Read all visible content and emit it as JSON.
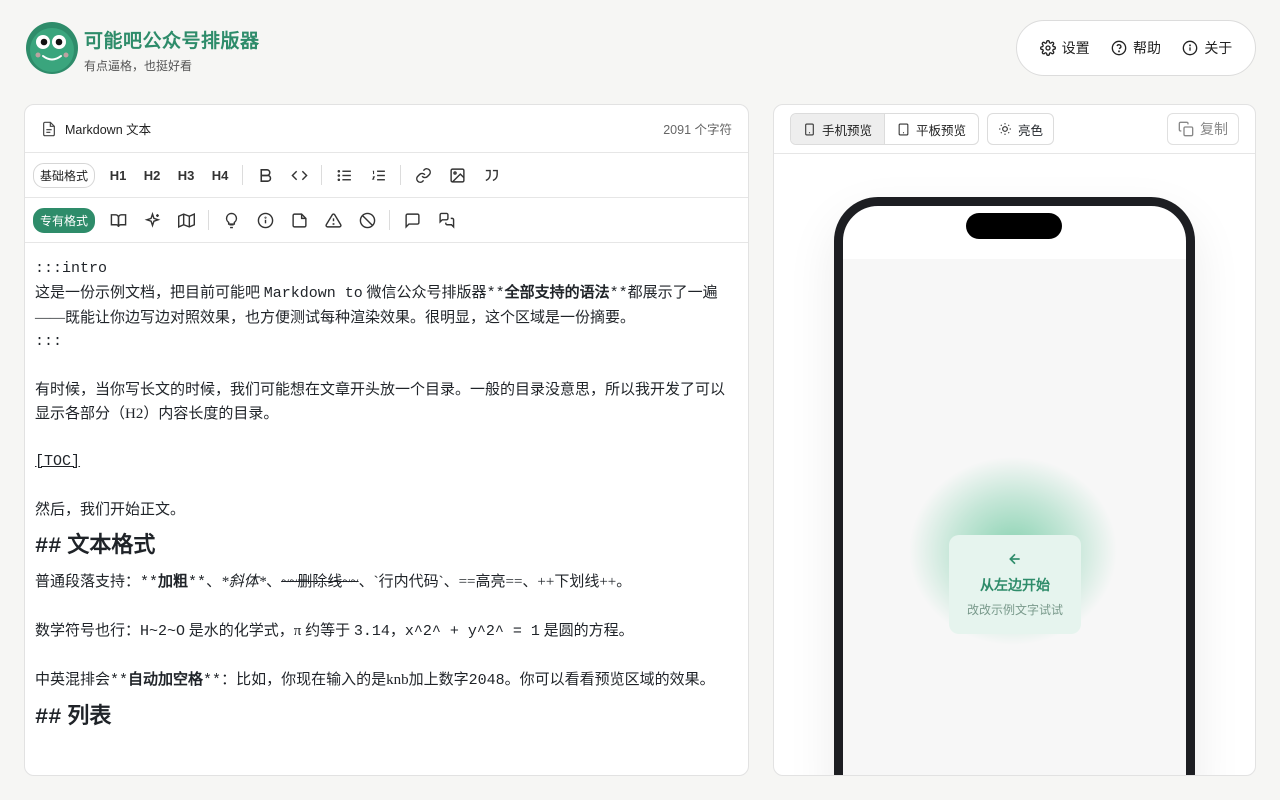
{
  "brand": {
    "title": "可能吧公众号排版器",
    "subtitle": "有点逼格，也挺好看"
  },
  "nav": {
    "settings": "设置",
    "help": "帮助",
    "about": "关于"
  },
  "editor": {
    "title": "Markdown 文本",
    "char_count": "2091 个字符",
    "toolbar1_label": "基础格式",
    "toolbar2_label": "专有格式",
    "headings": [
      "H1",
      "H2",
      "H3",
      "H4"
    ],
    "lines": {
      "l1": ":::intro",
      "l2a": "这是一份示例文档，把目前可能吧 ",
      "l2b": "Markdown to",
      "l2c": " 微信公众号排版器",
      "l2d": "**",
      "l2e": "全部支持的语法",
      "l2f": "**",
      "l2g": "都展示了一遍——既能让你边写边对照效果，也方便测试每种渲染效果。很明显，这个区域是一份摘要。",
      "l3": ":::",
      "l4": "有时候，当你写长文的时候，我们可能想在文章开头放一个目录。一般的目录没意思，所以我开发了可以显示各部分（H2）内容长度的目录。",
      "l5": "[TOC]",
      "l6": "然后，我们开始正文。",
      "h_format_mark": "##",
      "h_format": "文本格式",
      "l7a": "普通段落支持：",
      "l7b": "**",
      "l7c": "加粗",
      "l7d": "**",
      "l7e": "、",
      "l7f": "*斜体*",
      "l7g": "、",
      "l7h": "~~删除线~~",
      "l7i": "、`行内代码`、==高亮==、++下划线++。",
      "l8a": "数学符号也行：",
      "l8b": "H~2~O",
      "l8c": " 是水的化学式，π 约等于 ",
      "l8d": "3.14",
      "l8e": "，",
      "l8f": "x^2^ + y^2^ = 1",
      "l8g": " 是圆的方程。",
      "l9a": "中英混排会",
      "l9b": "**",
      "l9c": "自动加空格",
      "l9d": "**",
      "l9e": "：比如，你现在输入的是knb加上数字",
      "l9f": "2048",
      "l9g": "。你可以看看预览区域的效果。",
      "h_list_mark": "##",
      "h_list": "列表"
    }
  },
  "preview": {
    "phone_tab": "手机预览",
    "tablet_tab": "平板预览",
    "theme": "亮色",
    "copy": "复制",
    "start_title": "从左边开始",
    "start_subtitle": "改改示例文字试试"
  },
  "colors": {
    "brand_green": "#2e8c6a",
    "background": "#f6f6f4"
  }
}
